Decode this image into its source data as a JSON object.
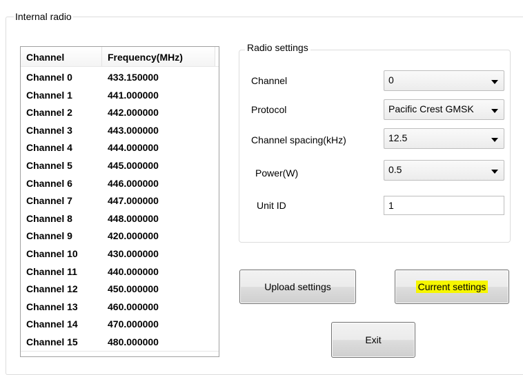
{
  "group": {
    "title": "Internal radio"
  },
  "table": {
    "headers": [
      "Channel",
      "Frequency(MHz)"
    ],
    "rows": [
      [
        "Channel 0",
        "433.150000"
      ],
      [
        "Channel 1",
        "441.000000"
      ],
      [
        "Channel 2",
        "442.000000"
      ],
      [
        "Channel 3",
        "443.000000"
      ],
      [
        "Channel 4",
        "444.000000"
      ],
      [
        "Channel 5",
        "445.000000"
      ],
      [
        "Channel 6",
        "446.000000"
      ],
      [
        "Channel 7",
        "447.000000"
      ],
      [
        "Channel 8",
        "448.000000"
      ],
      [
        "Channel 9",
        "420.000000"
      ],
      [
        "Channel 10",
        "430.000000"
      ],
      [
        "Channel 11",
        "440.000000"
      ],
      [
        "Channel 12",
        "450.000000"
      ],
      [
        "Channel 13",
        "460.000000"
      ],
      [
        "Channel 14",
        "470.000000"
      ],
      [
        "Channel 15",
        "480.000000"
      ]
    ]
  },
  "radio": {
    "title": "Radio settings",
    "channel": {
      "label": "Channel",
      "value": "0"
    },
    "protocol": {
      "label": "Protocol",
      "value": "Pacific Crest GMSK"
    },
    "spacing": {
      "label": "Channel spacing(kHz)",
      "value": "12.5"
    },
    "power": {
      "label": "Power(W)",
      "value": "0.5"
    },
    "unit_id": {
      "label": "Unit ID",
      "value": "1"
    }
  },
  "buttons": {
    "upload": "Upload settings",
    "current": "Current settings",
    "exit": "Exit"
  },
  "colors": {
    "highlight": "#f6f600"
  }
}
